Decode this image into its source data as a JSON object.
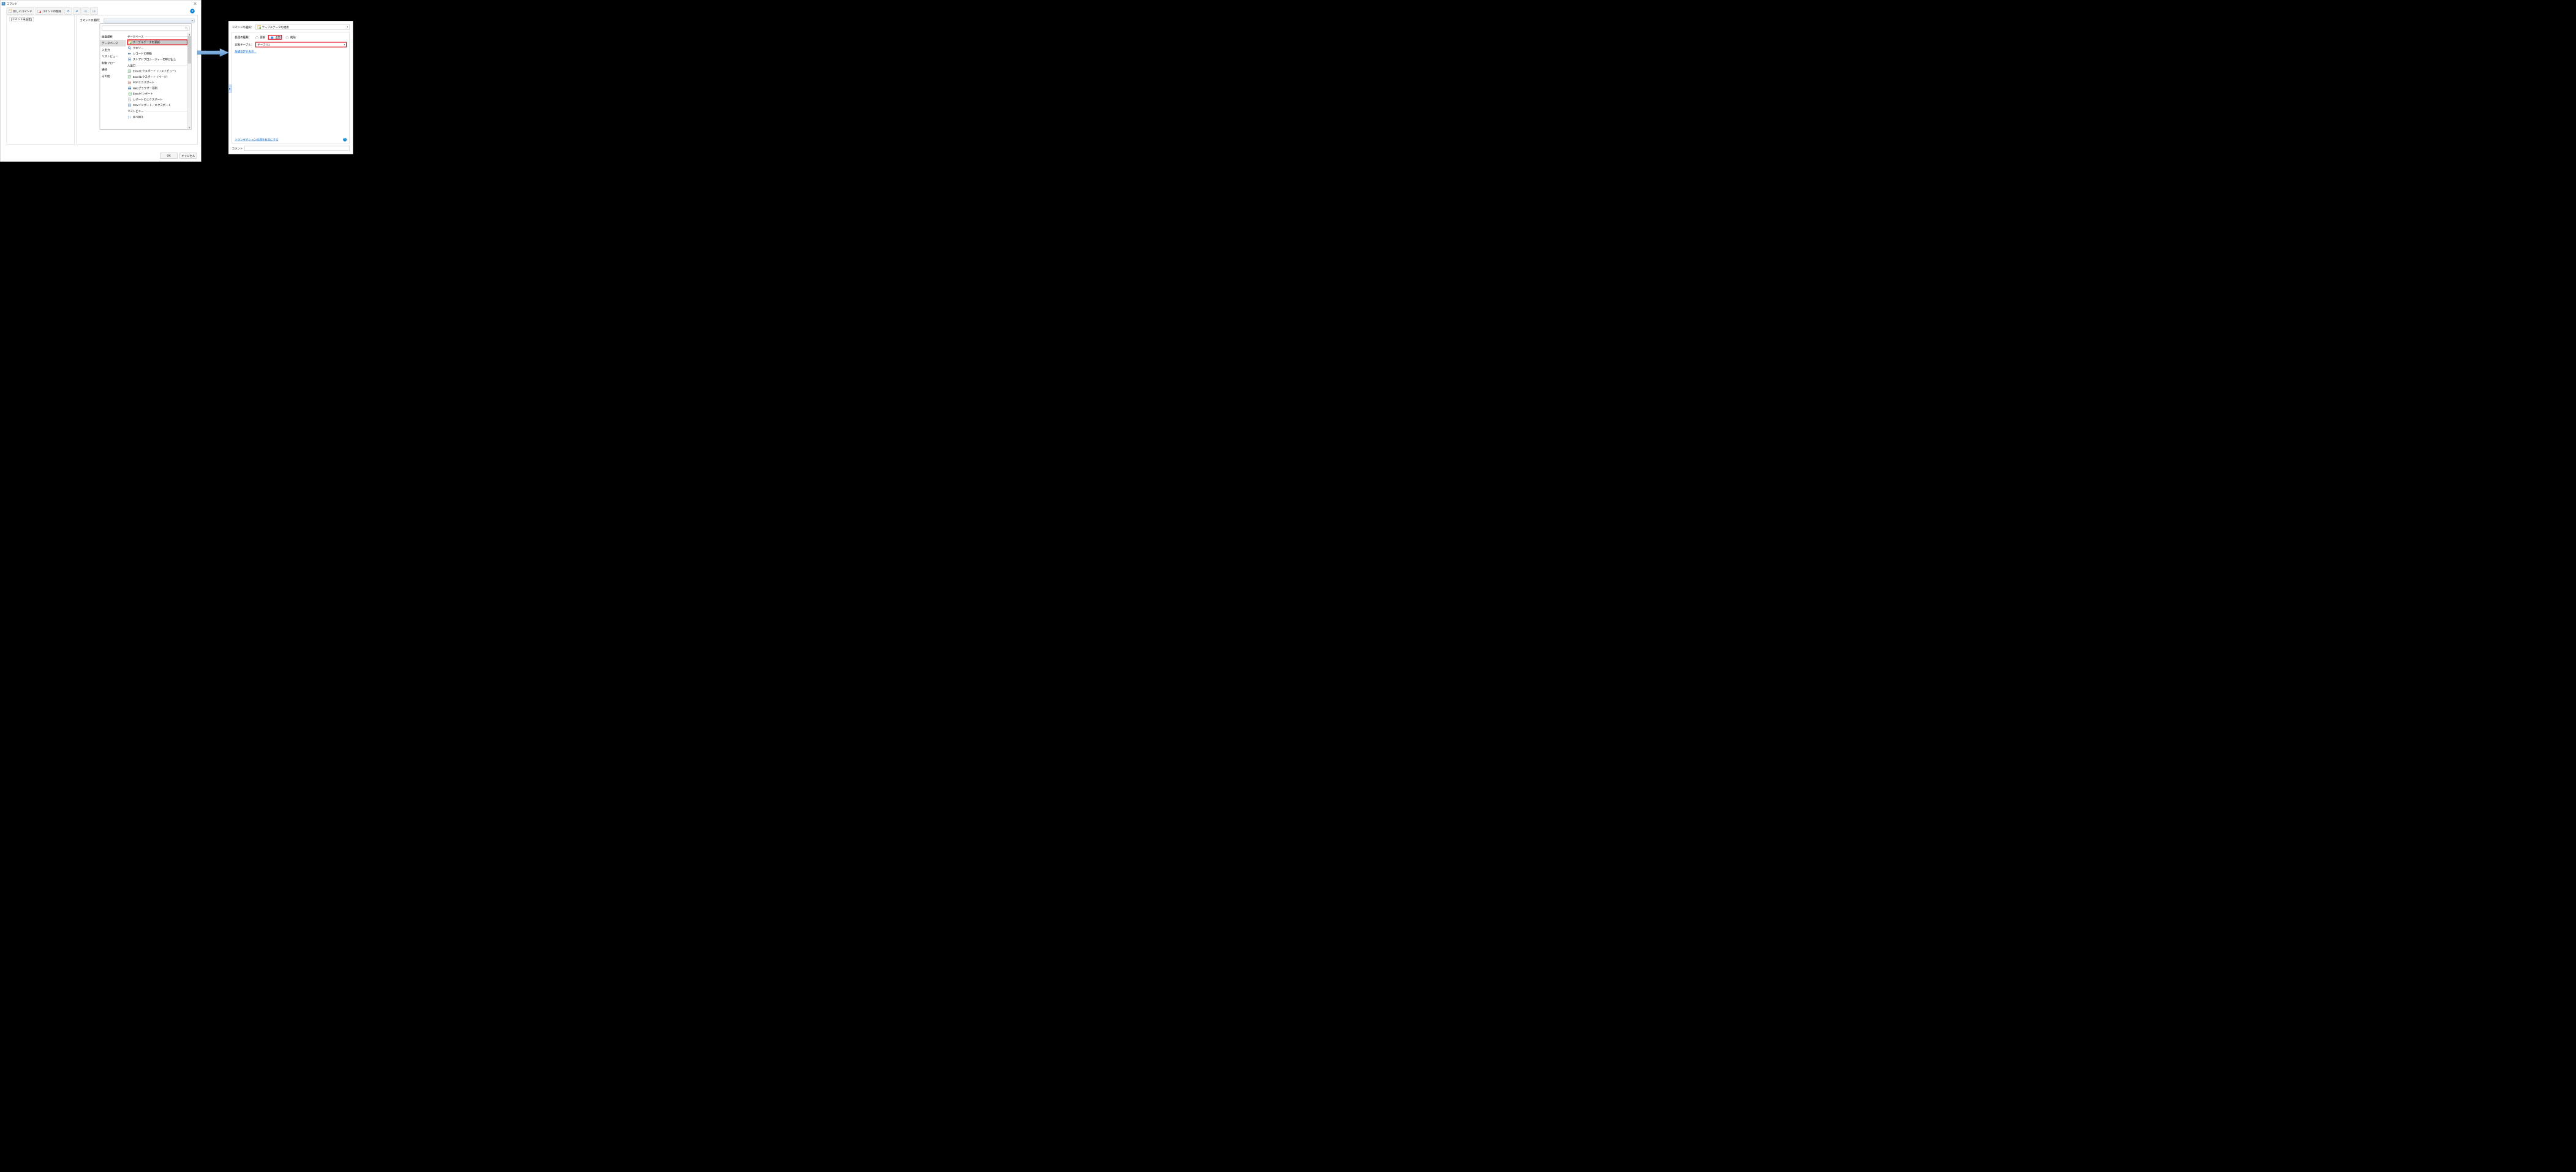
{
  "left": {
    "title": "コマンド",
    "toolbar": {
      "new_cmd": "新しいコマンド",
      "del_cmd": "コマンドの削除"
    },
    "placeholder": "[コマンド未設定]",
    "selectLabel": "コマンドの選択：",
    "categories": [
      "画面遷移",
      "データベース",
      "入出力",
      "リストビュー",
      "制御フロー",
      "通知",
      "その他"
    ],
    "selectedCategoryIndex": 1,
    "groups": [
      {
        "title": "データベース",
        "items": [
          {
            "label": "テーブルデータの更新",
            "selected": true
          },
          {
            "label": "クエリー"
          },
          {
            "label": "レコードの移動"
          },
          {
            "label": "ストアドプロシージャーの呼び出し"
          }
        ]
      },
      {
        "title": "入出力",
        "items": [
          {
            "label": "Excelエクスポート（リストビュー）"
          },
          {
            "label": "Excelエクスポート（ページ）"
          },
          {
            "label": "PDFエクスポート"
          },
          {
            "label": "Webブラウザー印刷"
          },
          {
            "label": "Excelインポート"
          },
          {
            "label": "レポートのエクスポート"
          },
          {
            "label": "CSVインポート／エクスポート"
          }
        ]
      },
      {
        "title": "リストビュー",
        "items": [
          {
            "label": "並べ替え"
          }
        ]
      }
    ],
    "ok": "OK",
    "cancel": "キャンセル"
  },
  "right": {
    "selectLabel": "コマンドの選択：",
    "selectedCommand": "テーブルデータの更新",
    "procTypeLabel": "処理の種類：",
    "radios": {
      "update": "更新",
      "add": "追加",
      "delete": "削除"
    },
    "selectedRadio": "add",
    "targetLabel": "対象テーブル：",
    "targetValue": "テーブル1",
    "detailLink": "詳細設定を表示…",
    "transLink": "トランザクション処理を有効にする",
    "commentLabel": "コメント"
  }
}
